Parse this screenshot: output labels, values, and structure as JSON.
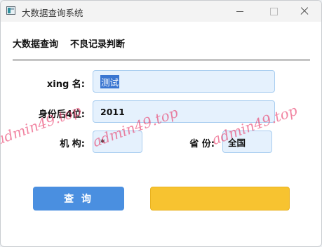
{
  "window": {
    "title": "大数据查询系统"
  },
  "menu": {
    "items": [
      "大数据查询",
      "不良记录判断"
    ]
  },
  "form": {
    "name_label": "xing 名:",
    "name_value": "测试",
    "id_label": "身份后4位:",
    "id_value": "2011",
    "org_label": "机 构:",
    "org_value": "*",
    "province_label": "省 份:",
    "province_value": "全国"
  },
  "buttons": {
    "query_label": "查 询",
    "second_label": ""
  },
  "watermark": {
    "text": "admin49.top"
  },
  "colors": {
    "input_bg": "#e5f1fd",
    "query_button": "#4a8fe0",
    "yellow_button": "#f7c330",
    "watermark": "#e93968"
  }
}
